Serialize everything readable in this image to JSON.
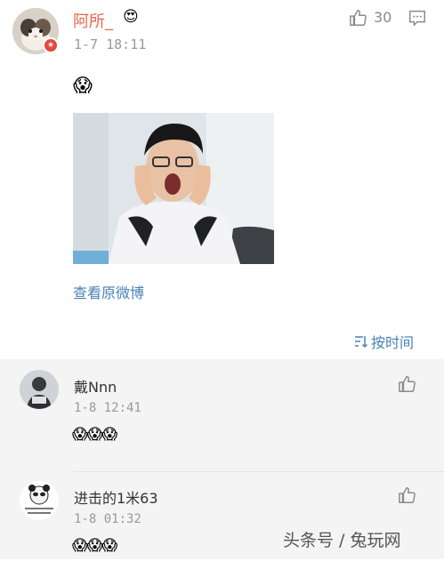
{
  "post": {
    "author": "阿所_",
    "crown_emoji": "😍",
    "time": "1-7 18:11",
    "like_count": "30",
    "body_emoji": "😱",
    "view_original": "查看原微博",
    "sort_label": "按时间",
    "icons": {
      "like": "thumbs-up-icon",
      "comment": "comment-icon",
      "sort": "sort-icon",
      "badge": "verified-badge-icon"
    }
  },
  "comments": [
    {
      "name": "戴Nnn",
      "time": "1-8 12:41",
      "emoji": "😱😱😱"
    },
    {
      "name": "进击的1米63",
      "time": "1-8 01:32",
      "emoji": "😱😱😱"
    }
  ],
  "watermark": "头条号 / 兔玩网",
  "colors": {
    "author": "#e8664a",
    "link": "#4a82b6",
    "meta": "#999999",
    "comment_bg": "#f4f4f4"
  }
}
